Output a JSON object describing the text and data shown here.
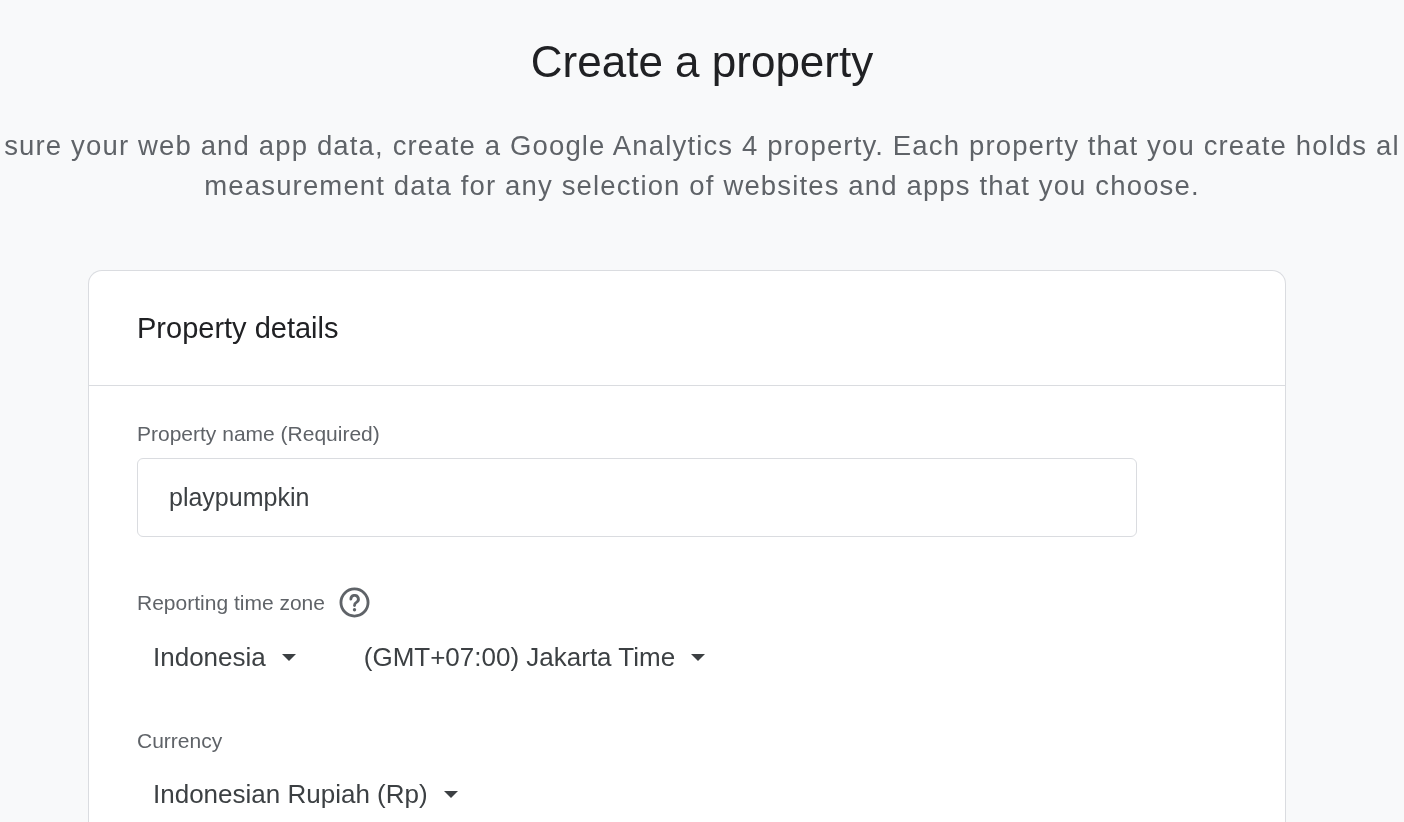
{
  "page": {
    "title": "Create a property",
    "description": "sure your web and app data, create a Google Analytics 4 property. Each property that you create holds al\nmeasurement data for any selection of websites and apps that you choose."
  },
  "card": {
    "title": "Property details",
    "property_name": {
      "label": "Property name (Required)",
      "value": "playpumpkin"
    },
    "time_zone": {
      "label": "Reporting time zone",
      "selects": [
        {
          "value": "Indonesia"
        },
        {
          "value": "(GMT+07:00) Jakarta Time"
        }
      ]
    },
    "currency": {
      "label": "Currency",
      "select": {
        "value": "Indonesian Rupiah (Rp)"
      }
    }
  }
}
